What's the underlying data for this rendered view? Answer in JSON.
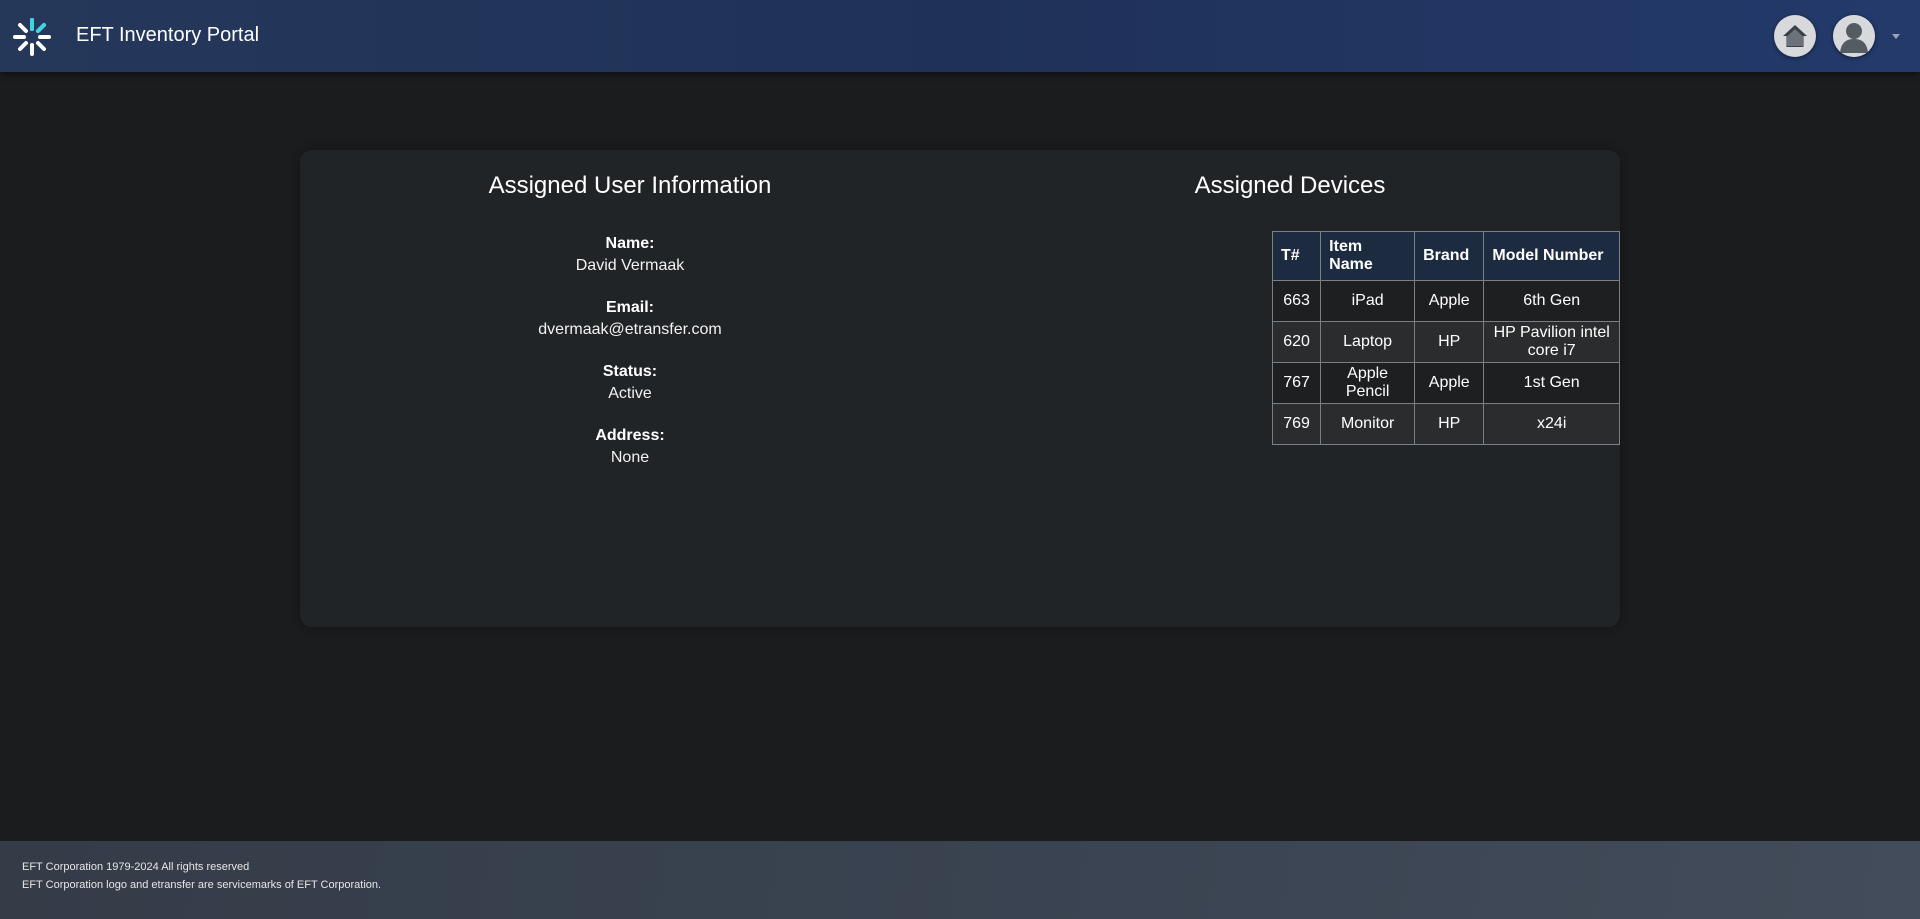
{
  "header": {
    "app_title": "EFT Inventory Portal",
    "logo_icon": "spinner-burst-logo",
    "home_icon": "home-icon",
    "avatar_icon": "user-avatar-icon",
    "caret_icon": "caret-down-icon"
  },
  "user_info": {
    "title": "Assigned User Information",
    "fields": [
      {
        "label": "Name:",
        "value": "David Vermaak"
      },
      {
        "label": "Email:",
        "value": "dvermaak@etransfer.com"
      },
      {
        "label": "Status:",
        "value": "Active"
      },
      {
        "label": "Address:",
        "value": "None"
      }
    ]
  },
  "devices": {
    "title": "Assigned Devices",
    "columns": [
      "T#",
      "Item Name",
      "Brand",
      "Model Number"
    ],
    "rows": [
      [
        "663",
        "iPad",
        "Apple",
        "6th Gen"
      ],
      [
        "620",
        "Laptop",
        "HP",
        "HP Pavilion intel core i7"
      ],
      [
        "767",
        "Apple Pencil",
        "Apple",
        "1st Gen"
      ],
      [
        "769",
        "Monitor",
        "HP",
        "x24i"
      ]
    ]
  },
  "footer": {
    "line1": "EFT Corporation 1979-2024 All rights reserved",
    "line2": "EFT Corporation logo and etransfer are servicemarks of EFT Corporation."
  },
  "colors": {
    "header_bg": "#1f3158",
    "table_header_bg": "#1c2b40",
    "card_bg": "#212427",
    "page_bg": "#1b1c1e",
    "logo_accent": "#3fd3e0"
  }
}
